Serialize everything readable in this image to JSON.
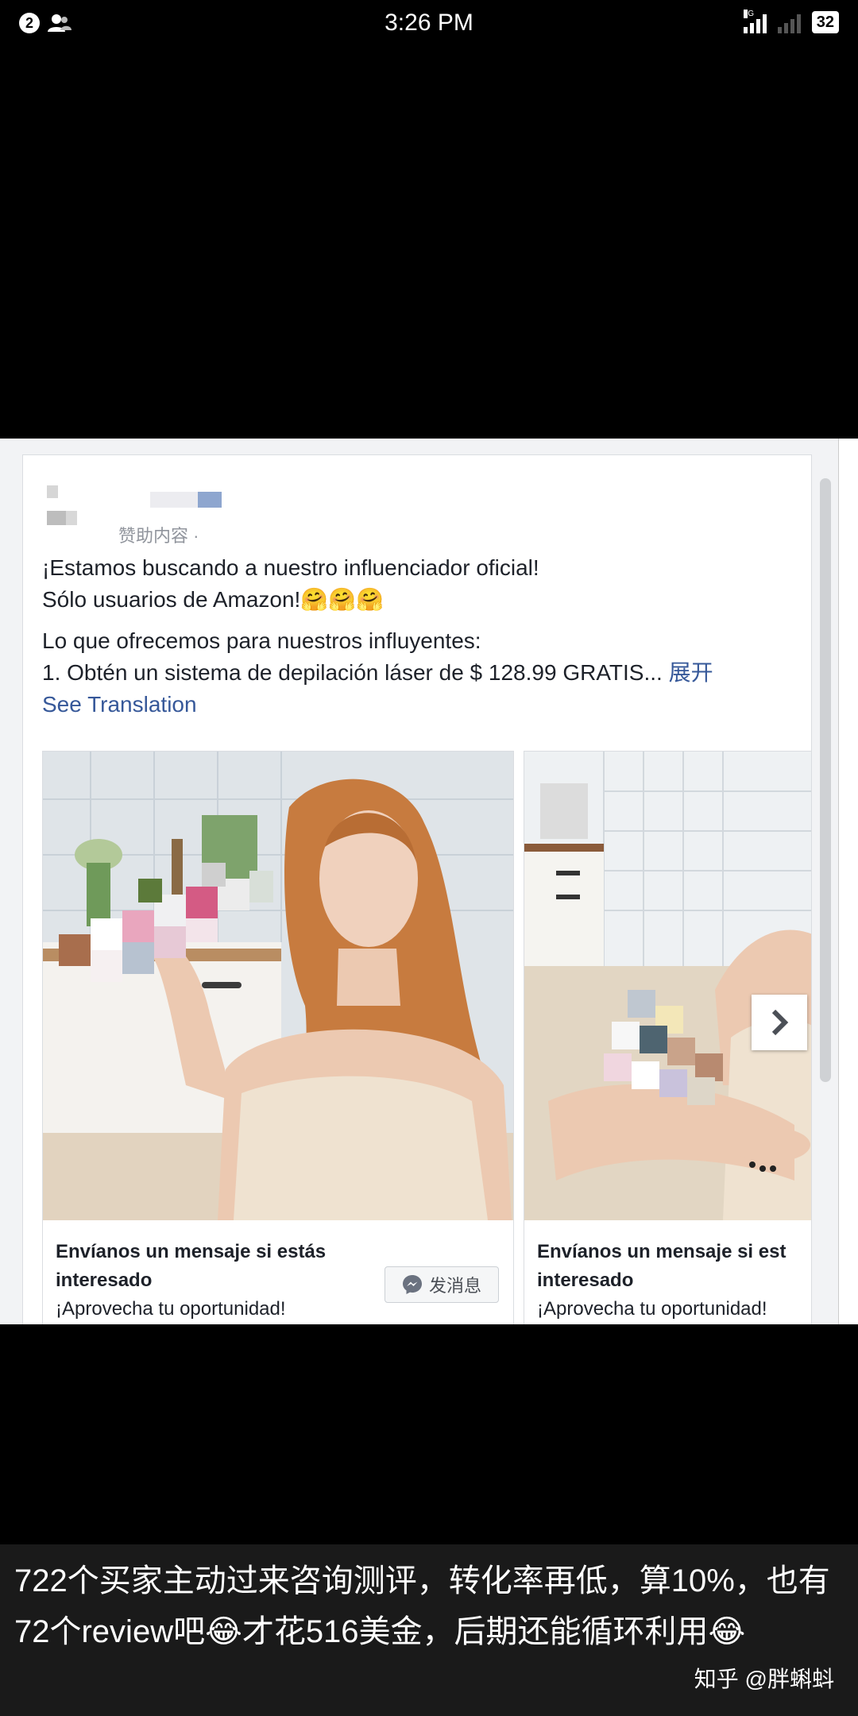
{
  "status_bar": {
    "notification_count": "2",
    "time": "3:26 PM",
    "network_label": "4G",
    "battery": "32"
  },
  "post": {
    "sponsored_label": "赞助内容 ·",
    "lines": [
      "¡Estamos buscando a nuestro influenciador oficial!",
      "Sólo usuarios de Amazon!🤗🤗🤗",
      "Lo que ofrecemos para nuestros influyentes:",
      "1. Obtén un sistema de depilación láser de $ 128.99 GRATIS..."
    ],
    "expand_label": "展开",
    "see_translation": "See Translation"
  },
  "carousel": {
    "cards": [
      {
        "title_line1": "Envíanos un mensaje si estás",
        "title_line2": "interesado",
        "subtitle": "¡Aprovecha tu oportunidad!",
        "button_label": "发消息"
      },
      {
        "title_line1": "Envíanos un mensaje si est",
        "title_line2": "interesado",
        "subtitle": "¡Aprovecha tu oportunidad!"
      }
    ]
  },
  "caption": {
    "text": "722个买家主动过来咨询测评，转化率再低，算10%，也有72个review吧😂才花516美金，后期还能循环利用😂",
    "credit": "知乎 @胖蝌蚪"
  },
  "colors": {
    "link": "#365899",
    "page_bg": "#000000",
    "card_bg": "#ffffff",
    "caption_bg": "#1a1a1a"
  }
}
